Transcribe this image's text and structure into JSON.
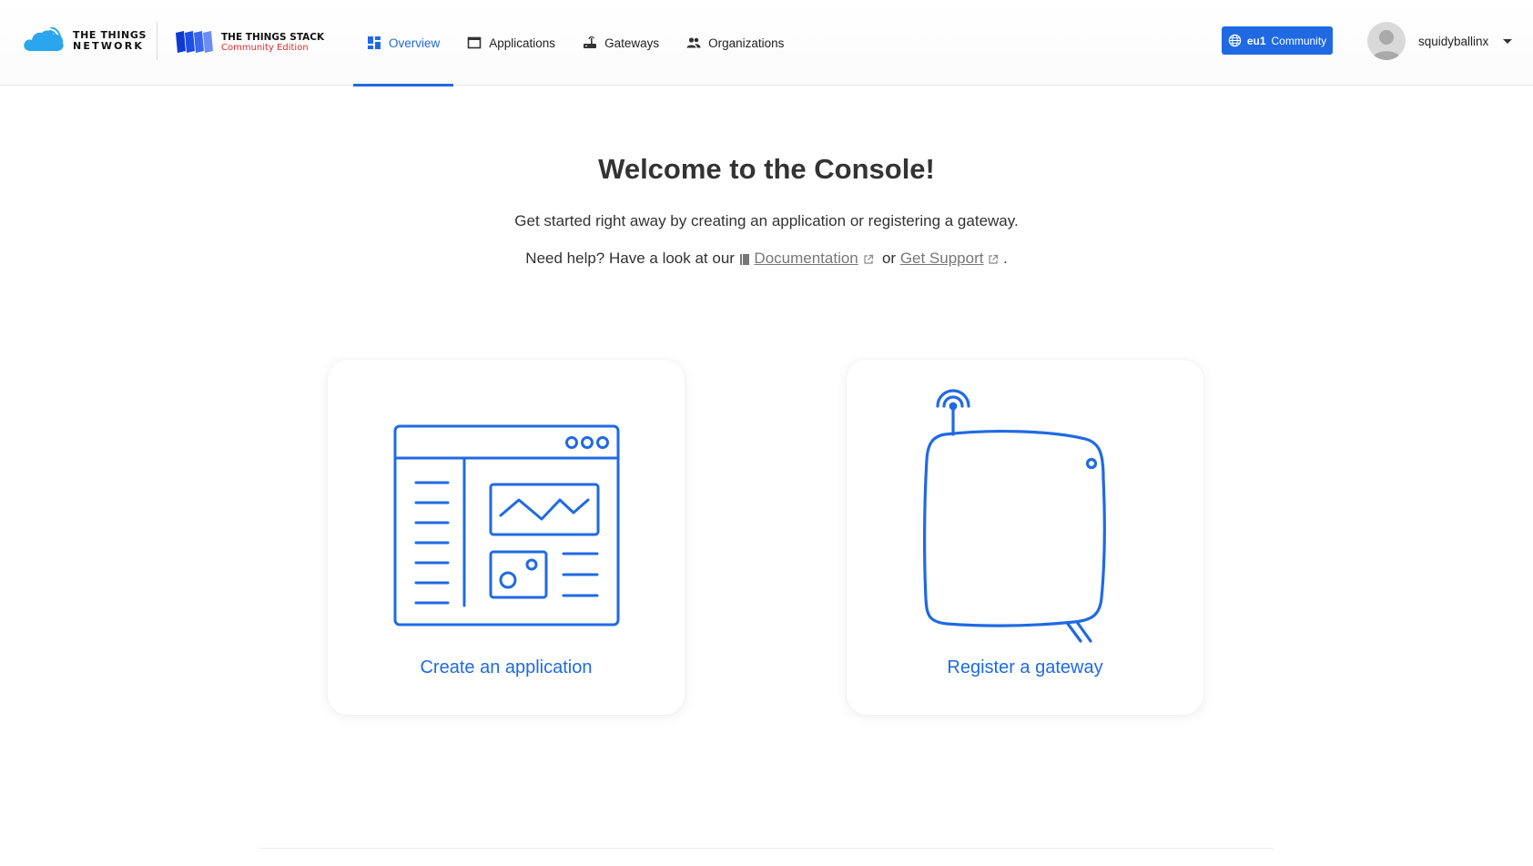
{
  "brand": {
    "network_line1": "THE THINGS",
    "network_line2": "NETWORK",
    "stack_line1": "THE THINGS STACK",
    "stack_line2": "Community Edition"
  },
  "nav": {
    "items": [
      {
        "label": "Overview",
        "icon": "dashboard-icon",
        "active": true
      },
      {
        "label": "Applications",
        "icon": "window-icon",
        "active": false
      },
      {
        "label": "Gateways",
        "icon": "router-icon",
        "active": false
      },
      {
        "label": "Organizations",
        "icon": "people-icon",
        "active": false
      }
    ]
  },
  "cluster": {
    "region": "eu1",
    "label": "Community",
    "icon": "globe-icon"
  },
  "user": {
    "name": "squidyballinx",
    "icon": "avatar-icon"
  },
  "welcome": {
    "title": "Welcome to the Console!",
    "subtitle": "Get started right away by creating an application or registering a gateway.",
    "help_prefix": "Need help? Have a look at our",
    "documentation_label": "Documentation",
    "or_text": "or",
    "support_label": "Get Support",
    "period": "."
  },
  "cards": {
    "application_label": "Create an application",
    "gateway_label": "Register a gateway"
  },
  "colors": {
    "accent": "#1f6ae3",
    "brand_red": "#e32b2b"
  }
}
